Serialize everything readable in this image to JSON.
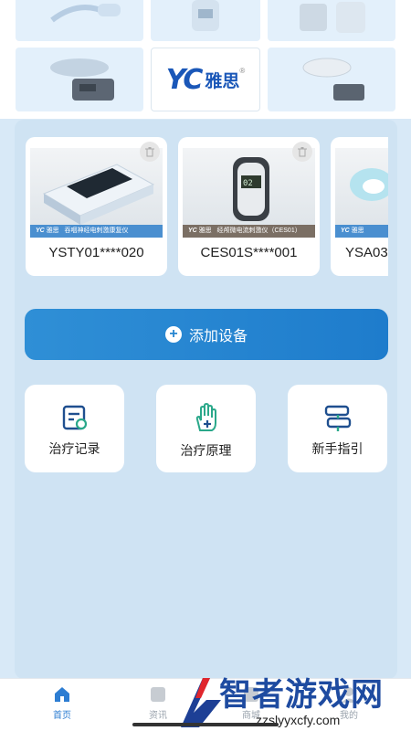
{
  "brand": {
    "mark_yc": "YC",
    "name_cn": "雅思",
    "registered": "®"
  },
  "product_grid": [
    {
      "name": "product-tile-1"
    },
    {
      "name": "product-tile-2"
    },
    {
      "name": "product-tile-3"
    },
    {
      "name": "product-tile-4"
    },
    {
      "name": "product-tile-brand"
    },
    {
      "name": "product-tile-6"
    }
  ],
  "devices": [
    {
      "id": "YSTY01****020",
      "banner": "吞咽神经电刺激康复仪",
      "banner_color": "#4a8fd0"
    },
    {
      "id": "CES01S****001",
      "banner": "经颅微电流刺激仪（CES01）",
      "banner_color": "#7b6f64"
    },
    {
      "id": "YSA03",
      "banner": "",
      "banner_color": "#4a8fd0"
    }
  ],
  "add_device": {
    "label": "添加设备"
  },
  "functions": [
    {
      "label": "治疗记录",
      "icon": "record-icon"
    },
    {
      "label": "治疗原理",
      "icon": "hand-plus-icon"
    },
    {
      "label": "新手指引",
      "icon": "signpost-icon"
    }
  ],
  "tabbar": [
    {
      "label": "首页",
      "active": true
    },
    {
      "label": "资讯",
      "active": false
    },
    {
      "label": "商城",
      "active": false
    },
    {
      "label": "我的",
      "active": false
    }
  ],
  "watermark": {
    "title": "智者游戏网",
    "url": "zzslyyxcfy.com"
  },
  "colors": {
    "accent": "#2585d0",
    "panel": "#cfe3f3",
    "page": "#d8e9f7"
  }
}
